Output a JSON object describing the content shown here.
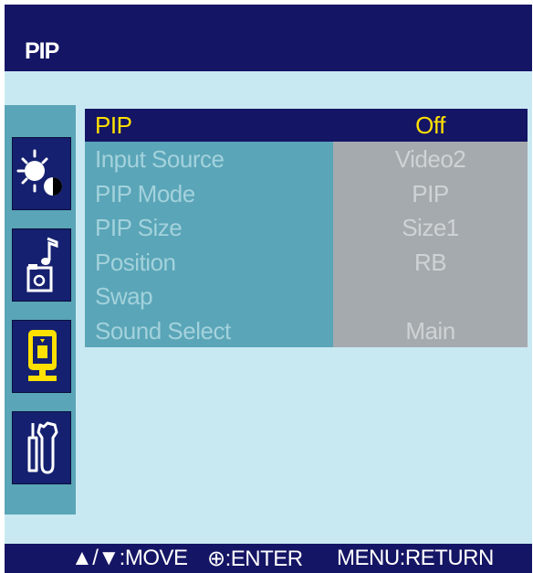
{
  "header": {
    "title": "PIP"
  },
  "sidebar": {
    "icons": [
      "picture-brightness-contrast-icon",
      "sound-music-note-icon",
      "pip-monitor-icon",
      "setup-tools-icon"
    ],
    "active_index": 2
  },
  "menu": {
    "items": [
      {
        "label": "PIP",
        "value": "Off",
        "selected": true
      },
      {
        "label": "Input Source",
        "value": "Video2",
        "selected": false
      },
      {
        "label": "PIP Mode",
        "value": "PIP",
        "selected": false
      },
      {
        "label": "PIP Size",
        "value": "Size1",
        "selected": false
      },
      {
        "label": "Position",
        "value": "RB",
        "selected": false
      },
      {
        "label": "Swap",
        "value": "",
        "selected": false
      },
      {
        "label": "Sound Select",
        "value": "Main",
        "selected": false
      }
    ]
  },
  "footer": {
    "move": "▲/▼:MOVE",
    "enter": "⊕:ENTER",
    "return": "MENU:RETURN"
  },
  "colors": {
    "header_bg": "#151565",
    "panel_bg": "#c9e9f2",
    "label_bg": "#5aa5b8",
    "value_bg": "#a5aaae",
    "selected_text": "#ffe000",
    "disabled_label_text": "#a3d2dc",
    "disabled_value_text": "#cfd3d5"
  }
}
